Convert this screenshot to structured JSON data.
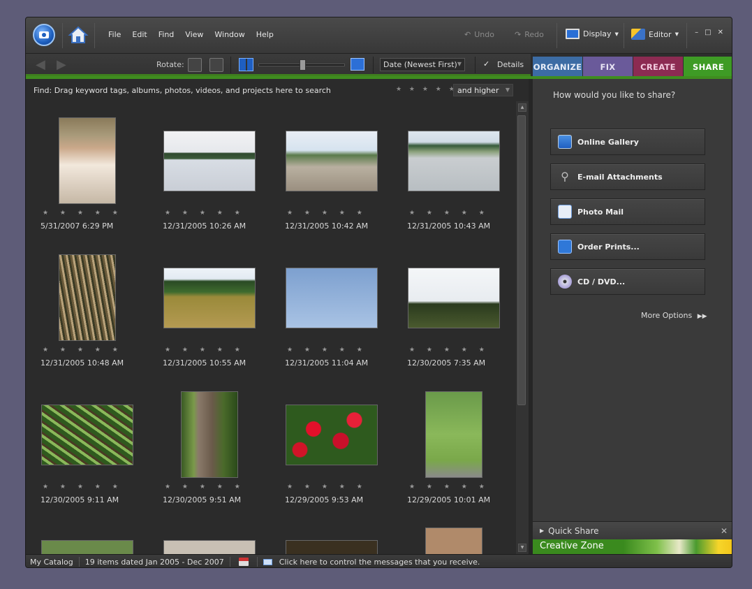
{
  "menu": {
    "items": [
      "File",
      "Edit",
      "Find",
      "View",
      "Window",
      "Help"
    ],
    "undo": "Undo",
    "redo": "Redo",
    "display": "Display",
    "editor": "Editor"
  },
  "toolbar": {
    "rotate_label": "Rotate:",
    "sort_value": "Date (Newest First)",
    "details_label": "Details",
    "details_checked": true
  },
  "tabs": [
    {
      "label": "ORGANIZE",
      "color": "#3c6ca4",
      "text": "#e8eef8"
    },
    {
      "label": "FIX",
      "color": "#6a5a9a",
      "text": "#e8e4f4"
    },
    {
      "label": "CREATE",
      "color": "#8c2b52",
      "text": "#f3cde0"
    },
    {
      "label": "SHARE",
      "color": "#3e9b25",
      "text": "#ffffff"
    }
  ],
  "find": {
    "text": "Find: Drag keyword tags, albums, photos, videos, and projects here to search",
    "rating": "★ ★ ★ ★ ★",
    "filter": "and higher"
  },
  "photos": [
    {
      "date": "5/31/2007 6:29 PM",
      "kind": "person"
    },
    {
      "date": "12/31/2005 10:26 AM",
      "kind": "water"
    },
    {
      "date": "12/31/2005 10:42 AM",
      "kind": "mangrove"
    },
    {
      "date": "12/31/2005 10:43 AM",
      "kind": "heron"
    },
    {
      "date": "12/31/2005 10:48 AM",
      "kind": "roots"
    },
    {
      "date": "12/31/2005 10:55 AM",
      "kind": "marsh"
    },
    {
      "date": "12/31/2005 11:04 AM",
      "kind": "vulture"
    },
    {
      "date": "12/30/2005 7:35 AM",
      "kind": "tree"
    },
    {
      "date": "12/30/2005 9:11 AM",
      "kind": "forest"
    },
    {
      "date": "12/30/2005 9:51 AM",
      "kind": "rubber"
    },
    {
      "date": "12/29/2005 9:53 AM",
      "kind": "flowers"
    },
    {
      "date": "12/29/2005 10:01 AM",
      "kind": "hiker"
    }
  ],
  "share": {
    "question": "How would you like to share?",
    "buttons": [
      "Online Gallery",
      "E-mail Attachments",
      "Photo Mail",
      "Order Prints...",
      "CD / DVD..."
    ],
    "more": "More Options"
  },
  "quick_share": "Quick Share",
  "creative_zone": "Creative Zone",
  "status": {
    "catalog": "My Catalog",
    "items": "19 items dated Jan 2005 - Dec 2007",
    "message": "Click here to control the messages that you receive."
  },
  "stars": "★ ★ ★ ★ ★"
}
